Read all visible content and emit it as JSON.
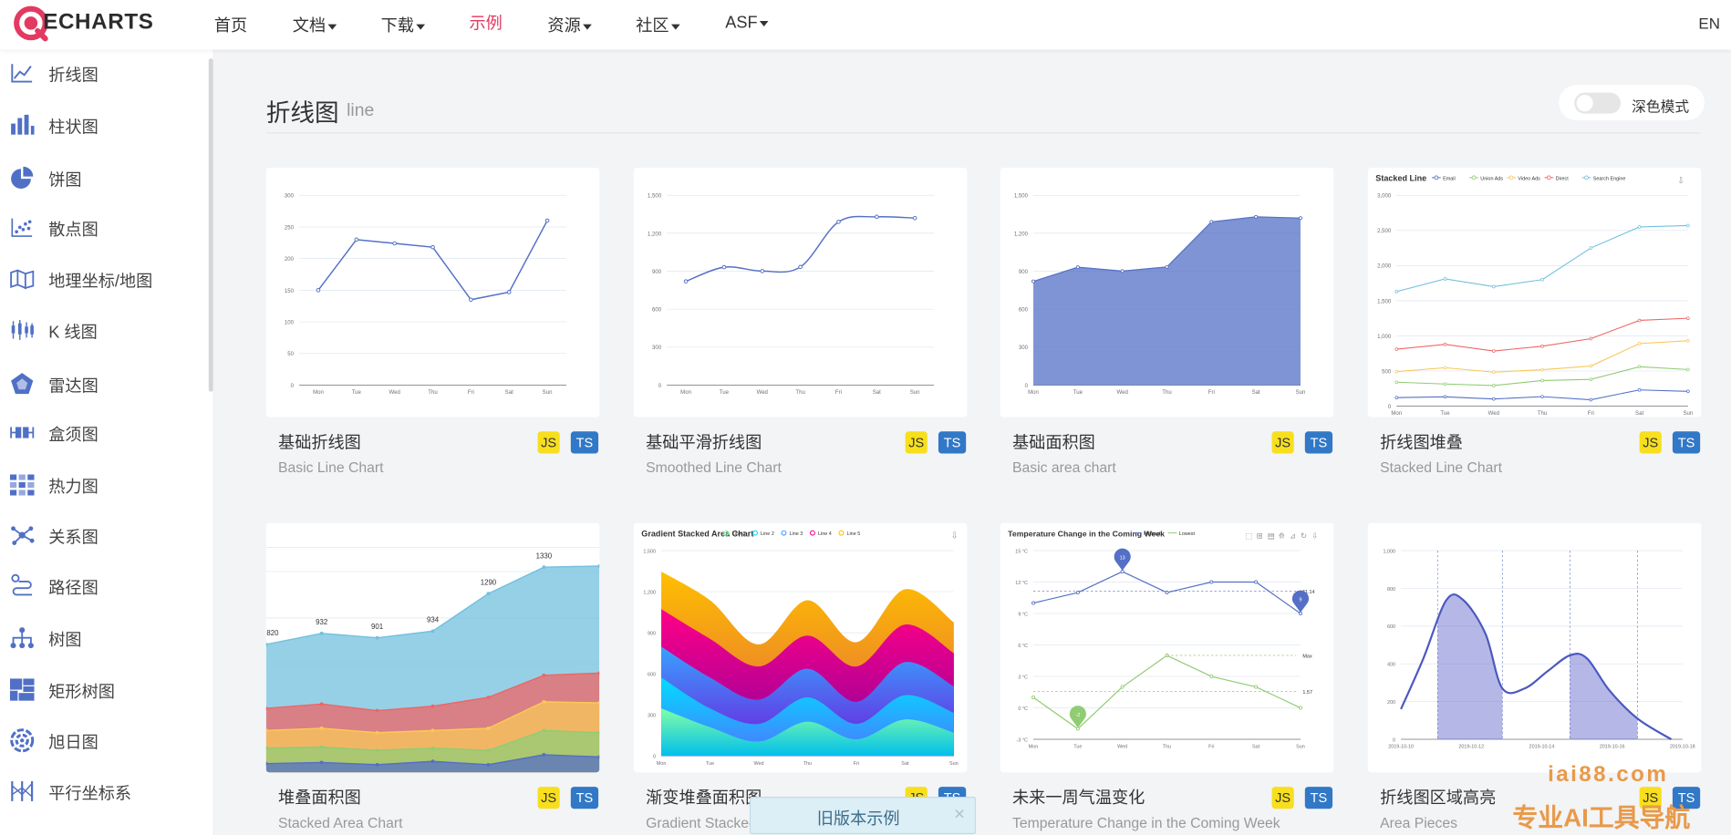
{
  "nav": {
    "logo": "ECHARTS",
    "items": [
      {
        "label": "首页",
        "caret": false,
        "active": false
      },
      {
        "label": "文档",
        "caret": true,
        "active": false
      },
      {
        "label": "下载",
        "caret": true,
        "active": false
      },
      {
        "label": "示例",
        "caret": false,
        "active": true
      },
      {
        "label": "资源",
        "caret": true,
        "active": false
      },
      {
        "label": "社区",
        "caret": true,
        "active": false
      },
      {
        "label": "ASF",
        "caret": true,
        "active": false
      }
    ],
    "lang": "EN"
  },
  "sidebar": {
    "items": [
      {
        "label": "折线图",
        "icon": "line-chart-icon"
      },
      {
        "label": "柱状图",
        "icon": "bar-chart-icon"
      },
      {
        "label": "饼图",
        "icon": "pie-chart-icon"
      },
      {
        "label": "散点图",
        "icon": "scatter-chart-icon"
      },
      {
        "label": "地理坐标/地图",
        "icon": "map-icon"
      },
      {
        "label": "K 线图",
        "icon": "candlestick-icon"
      },
      {
        "label": "雷达图",
        "icon": "radar-icon"
      },
      {
        "label": "盒须图",
        "icon": "boxplot-icon"
      },
      {
        "label": "热力图",
        "icon": "heatmap-icon"
      },
      {
        "label": "关系图",
        "icon": "graph-icon"
      },
      {
        "label": "路径图",
        "icon": "lines-icon"
      },
      {
        "label": "树图",
        "icon": "tree-icon"
      },
      {
        "label": "矩形树图",
        "icon": "treemap-icon"
      },
      {
        "label": "旭日图",
        "icon": "sunburst-icon"
      },
      {
        "label": "平行坐标系",
        "icon": "parallel-icon"
      }
    ]
  },
  "main": {
    "title": "折线图",
    "subtitle": "line",
    "dark_mode_label": "深色模式"
  },
  "badges": {
    "js": "JS",
    "ts": "TS"
  },
  "cards": [
    {
      "title": "基础折线图",
      "subtitle": "Basic Line Chart"
    },
    {
      "title": "基础平滑折线图",
      "subtitle": "Smoothed Line Chart"
    },
    {
      "title": "基础面积图",
      "subtitle": "Basic area chart"
    },
    {
      "title": "折线图堆叠",
      "subtitle": "Stacked Line Chart"
    },
    {
      "title": "堆叠面积图",
      "subtitle": "Stacked Area Chart"
    },
    {
      "title": "渐变堆叠面积图",
      "subtitle": "Gradient Stacked Area Chart"
    },
    {
      "title": "未来一周气温变化",
      "subtitle": "Temperature Change in the Coming Week"
    },
    {
      "title": "折线图区域高亮",
      "subtitle": "Area Pieces"
    }
  ],
  "toast": {
    "label": "旧版本示例",
    "close": "×"
  },
  "watermark": {
    "line1": "iai88.com",
    "line2": "专业AI工具导航"
  },
  "colors": {
    "accent": "#e43961",
    "series_blue": "#5470c6",
    "js_badge": "#f7df1e",
    "ts_badge": "#3178c6"
  },
  "chart_data": [
    {
      "type": "line",
      "categories": [
        "Mon",
        "Tue",
        "Wed",
        "Thu",
        "Fri",
        "Sat",
        "Sun"
      ],
      "values": [
        150,
        230,
        224,
        218,
        135,
        147,
        260
      ],
      "ylim": [
        0,
        300
      ],
      "yticks": [
        0,
        50,
        100,
        150,
        200,
        250,
        300
      ]
    },
    {
      "type": "line",
      "smooth": true,
      "categories": [
        "Mon",
        "Tue",
        "Wed",
        "Thu",
        "Fri",
        "Sat",
        "Sun"
      ],
      "values": [
        820,
        932,
        901,
        934,
        1290,
        1330,
        1320
      ],
      "ylim": [
        0,
        1500
      ],
      "yticks": [
        0,
        300,
        600,
        900,
        1200,
        1500
      ],
      "ytick_labels": [
        "0",
        "300",
        "600",
        "900",
        "1,200",
        "1,500"
      ]
    },
    {
      "type": "area",
      "categories": [
        "Mon",
        "Tue",
        "Wed",
        "Thu",
        "Fri",
        "Sat",
        "Sun"
      ],
      "values": [
        820,
        932,
        901,
        934,
        1290,
        1330,
        1320
      ],
      "ylim": [
        0,
        1500
      ],
      "yticks": [
        0,
        300,
        600,
        900,
        1200,
        1500
      ],
      "ytick_labels": [
        "0",
        "300",
        "600",
        "900",
        "1,200",
        "1,500"
      ]
    },
    {
      "type": "line",
      "title": "Stacked Line",
      "legend": [
        "Email",
        "Union Ads",
        "Video Ads",
        "Direct",
        "Search Engine"
      ],
      "categories": [
        "Mon",
        "Tue",
        "Wed",
        "Thu",
        "Fri",
        "Sat",
        "Sun"
      ],
      "series": [
        {
          "name": "Email",
          "values": [
            120,
            132,
            101,
            134,
            90,
            230,
            210
          ]
        },
        {
          "name": "Union Ads",
          "values": [
            340,
            314,
            292,
            364,
            380,
            560,
            520
          ]
        },
        {
          "name": "Video Ads",
          "values": [
            490,
            546,
            483,
            518,
            570,
            890,
            930
          ]
        },
        {
          "name": "Direct",
          "values": [
            810,
            878,
            784,
            852,
            960,
            1220,
            1250
          ]
        },
        {
          "name": "Search Engine",
          "values": [
            1630,
            1810,
            1700,
            1800,
            2250,
            2550,
            2570
          ]
        }
      ],
      "ylim": [
        0,
        3000
      ],
      "yticks": [
        0,
        500,
        1000,
        1500,
        2000,
        2500,
        3000
      ],
      "ytick_labels": [
        "0",
        "500",
        "1,000",
        "1,500",
        "2,000",
        "2,500",
        "3,000"
      ]
    },
    {
      "type": "area",
      "stacked": true,
      "categories": [
        "Mon",
        "Tue",
        "Wed",
        "Thu",
        "Fri",
        "Sat",
        "Sun"
      ],
      "visible_labels": [
        "820",
        "932",
        "901",
        "934",
        "1290",
        "1330"
      ],
      "top_values": [
        820,
        932,
        901,
        934,
        1290,
        1330,
        1320
      ]
    },
    {
      "type": "area",
      "stacked": true,
      "smooth": true,
      "title": "Gradient Stacked Area Chart",
      "legend": [
        "Line 1",
        "Line 2",
        "Line 3",
        "Line 4",
        "Line 5"
      ],
      "categories": [
        "Mon",
        "Tue",
        "Wed",
        "Thu",
        "Fri",
        "Sat",
        "Sun"
      ],
      "ylim": [
        0,
        1500
      ],
      "yticks": [
        0,
        300,
        600,
        900,
        1200,
        1500
      ],
      "ytick_labels": [
        "0",
        "300",
        "600",
        "900",
        "1,200",
        "1,500"
      ]
    },
    {
      "type": "line",
      "title": "Temperature Change in the Coming Week",
      "legend": [
        "Highest",
        "Lowest"
      ],
      "categories": [
        "Mon",
        "Tue",
        "Wed",
        "Thu",
        "Fri",
        "Sat",
        "Sun"
      ],
      "series": [
        {
          "name": "Highest",
          "values": [
            10,
            11,
            13,
            11,
            12,
            12,
            9
          ]
        },
        {
          "name": "Lowest",
          "values": [
            1,
            -2,
            2,
            5,
            3,
            2,
            0
          ]
        }
      ],
      "ylim": [
        -3,
        15
      ],
      "yticks": [
        -3,
        0,
        3,
        6,
        9,
        12,
        15
      ],
      "ytick_labels": [
        "-3 °C",
        "0 °C",
        "3 °C",
        "6 °C",
        "9 °C",
        "12 °C",
        "15 °C"
      ],
      "markers": [
        "13",
        "9",
        "-2"
      ],
      "marklines": [
        "11.14",
        "Max",
        "1.57"
      ]
    },
    {
      "type": "line",
      "smooth": true,
      "categories": [
        "2019-10-10",
        "2019-10-12",
        "2019-10-14",
        "2019-10-16",
        "2019-10-18"
      ],
      "x": [
        0,
        1,
        2,
        3,
        4
      ],
      "ylim": [
        0,
        1000
      ],
      "yticks": [
        0,
        200,
        400,
        600,
        800,
        1000
      ],
      "ytick_labels": [
        "0",
        "200",
        "400",
        "600",
        "800",
        "1,000"
      ]
    }
  ]
}
